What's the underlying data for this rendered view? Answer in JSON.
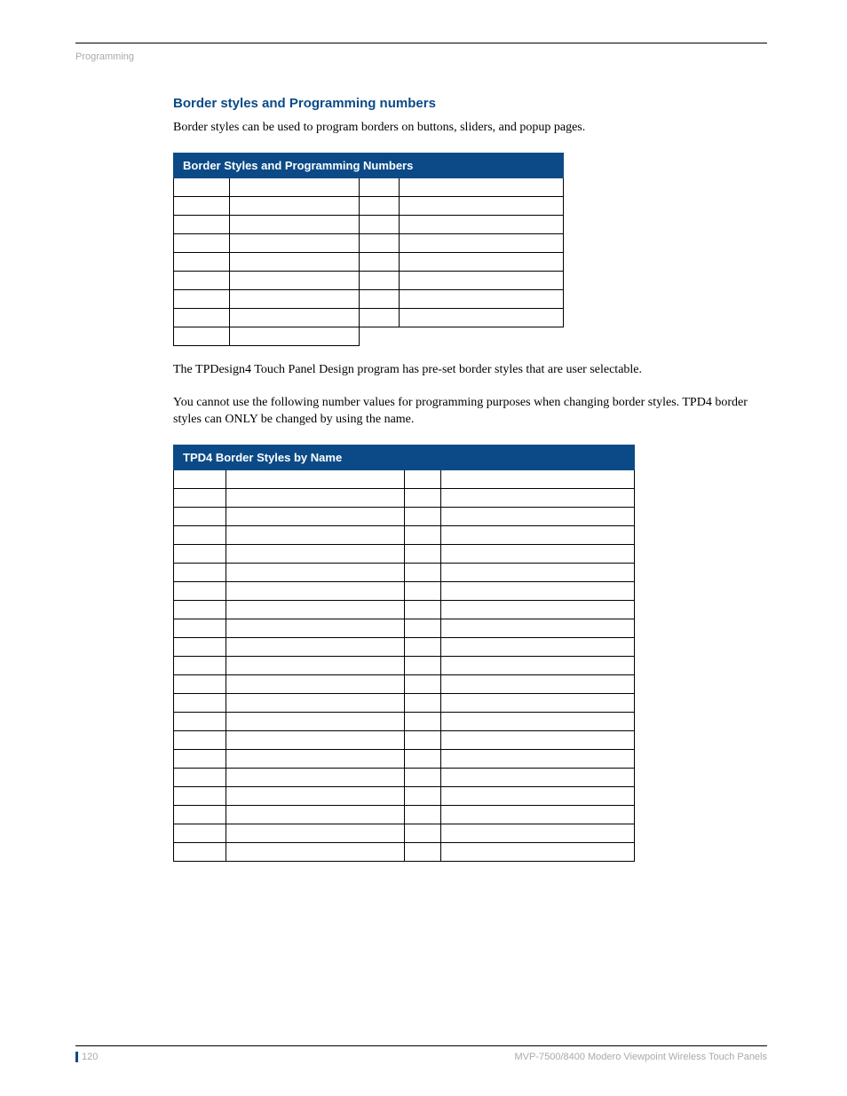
{
  "header": {
    "label": "Programming"
  },
  "section": {
    "title": "Border styles and Programming numbers",
    "intro": "Border styles can be used to program borders on buttons, sliders, and popup pages."
  },
  "table1": {
    "title": "Border Styles and Programming Numbers",
    "rows": 9
  },
  "mid": {
    "p1": "The TPDesign4 Touch Panel Design program has pre-set border styles that are user selectable.",
    "p2": "You cannot use the following number values for programming purposes when changing border styles. TPD4 border styles can ONLY be changed by using the name."
  },
  "table2": {
    "title": "TPD4 Border Styles by Name",
    "rows": 21
  },
  "footer": {
    "page": "120",
    "doc": "MVP-7500/8400 Modero Viewpoint Wireless Touch Panels"
  }
}
